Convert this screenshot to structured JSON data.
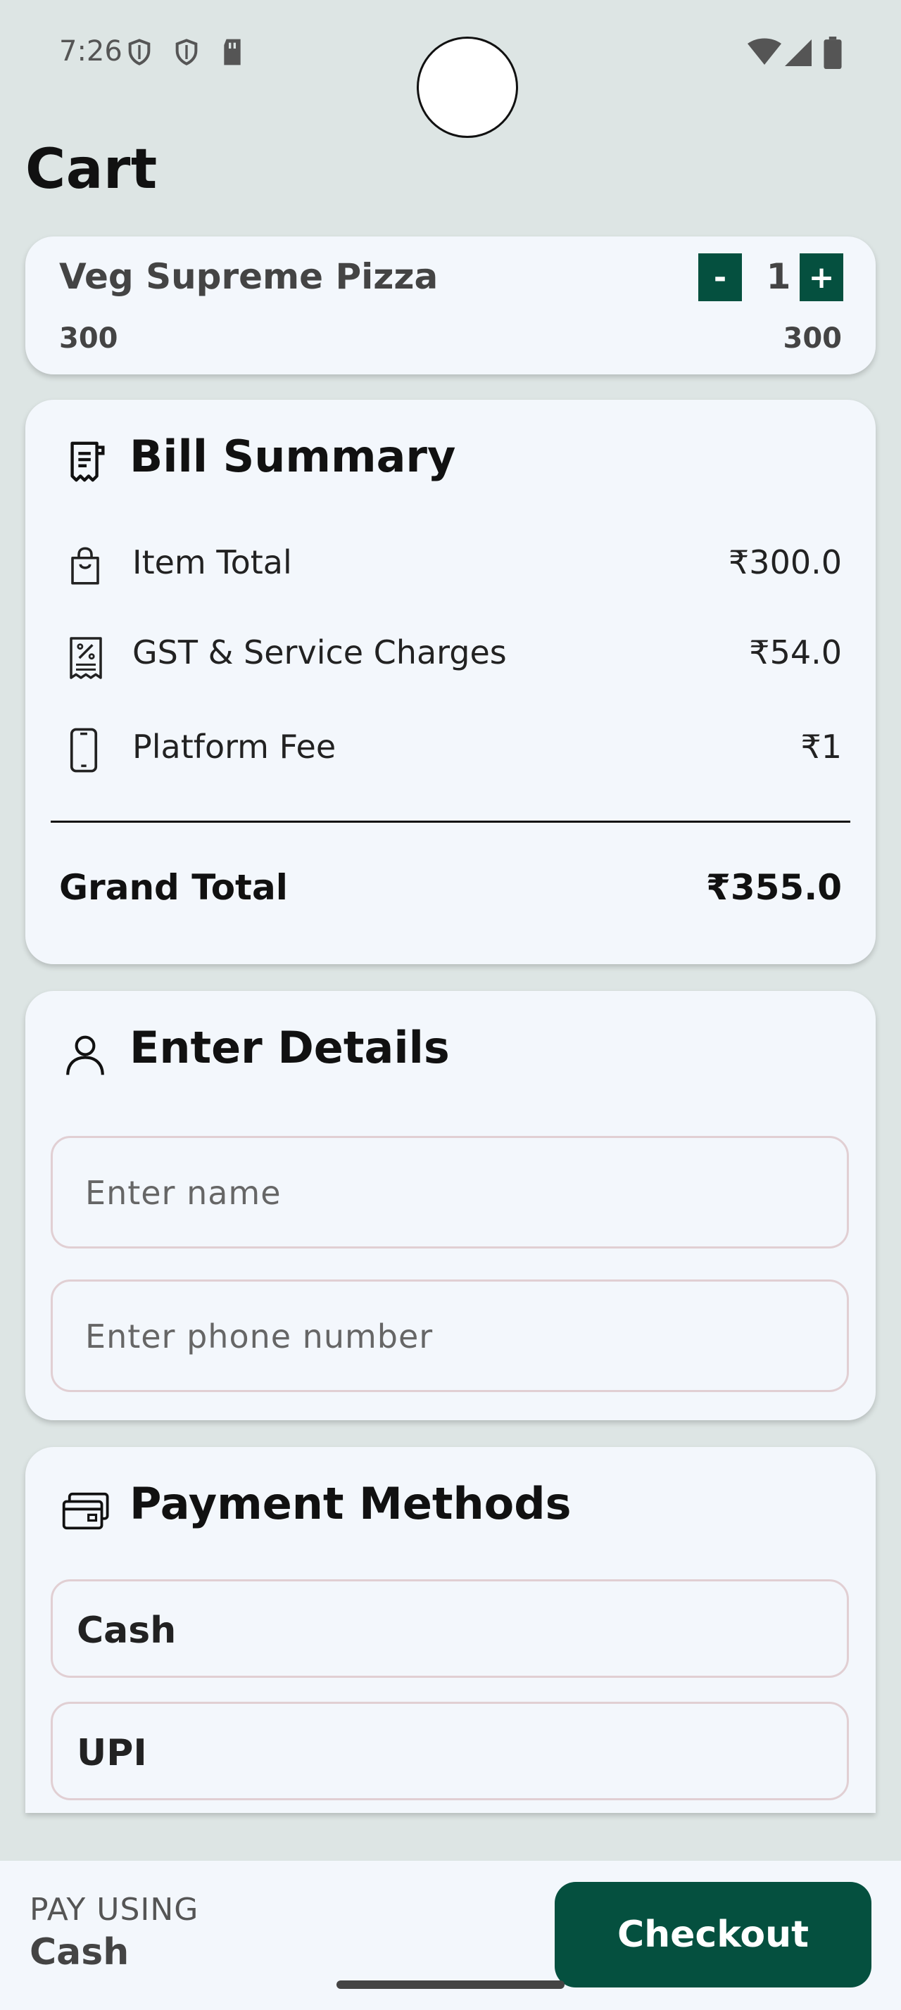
{
  "status_bar": {
    "time": "7:26",
    "left_icons": [
      "shield-icon",
      "shield-icon",
      "sd-card-icon"
    ],
    "right_icons": [
      "wifi-icon",
      "cellular-signal-icon",
      "battery-icon"
    ]
  },
  "page": {
    "title": "Cart"
  },
  "cart_item": {
    "name": "Veg Supreme Pizza",
    "price": "300",
    "subtotal": "300",
    "quantity": "1",
    "decrement_label": "-",
    "increment_label": "+"
  },
  "bill_summary": {
    "title": "Bill Summary",
    "rows": [
      {
        "icon": "shopping-bag-icon",
        "label": "Item Total",
        "value": "₹300.0"
      },
      {
        "icon": "tax-receipt-icon",
        "label": "GST & Service Charges",
        "value": "₹54.0"
      },
      {
        "icon": "phone-icon",
        "label": "Platform Fee",
        "value": "₹1"
      }
    ],
    "grand_total_label": "Grand Total",
    "grand_total_value": "₹355.0"
  },
  "details": {
    "title": "Enter Details",
    "name_placeholder": "Enter name",
    "name_value": "",
    "phone_placeholder": "Enter phone number",
    "phone_value": ""
  },
  "payment": {
    "title": "Payment Methods",
    "options": [
      "Cash",
      "UPI"
    ]
  },
  "bottom_bar": {
    "pay_using_label": "PAY USING",
    "selected_method": "Cash",
    "checkout_label": "Checkout"
  },
  "colors": {
    "accent": "#05503f",
    "background": "#dde5e4",
    "card": "#f3f7fc"
  }
}
